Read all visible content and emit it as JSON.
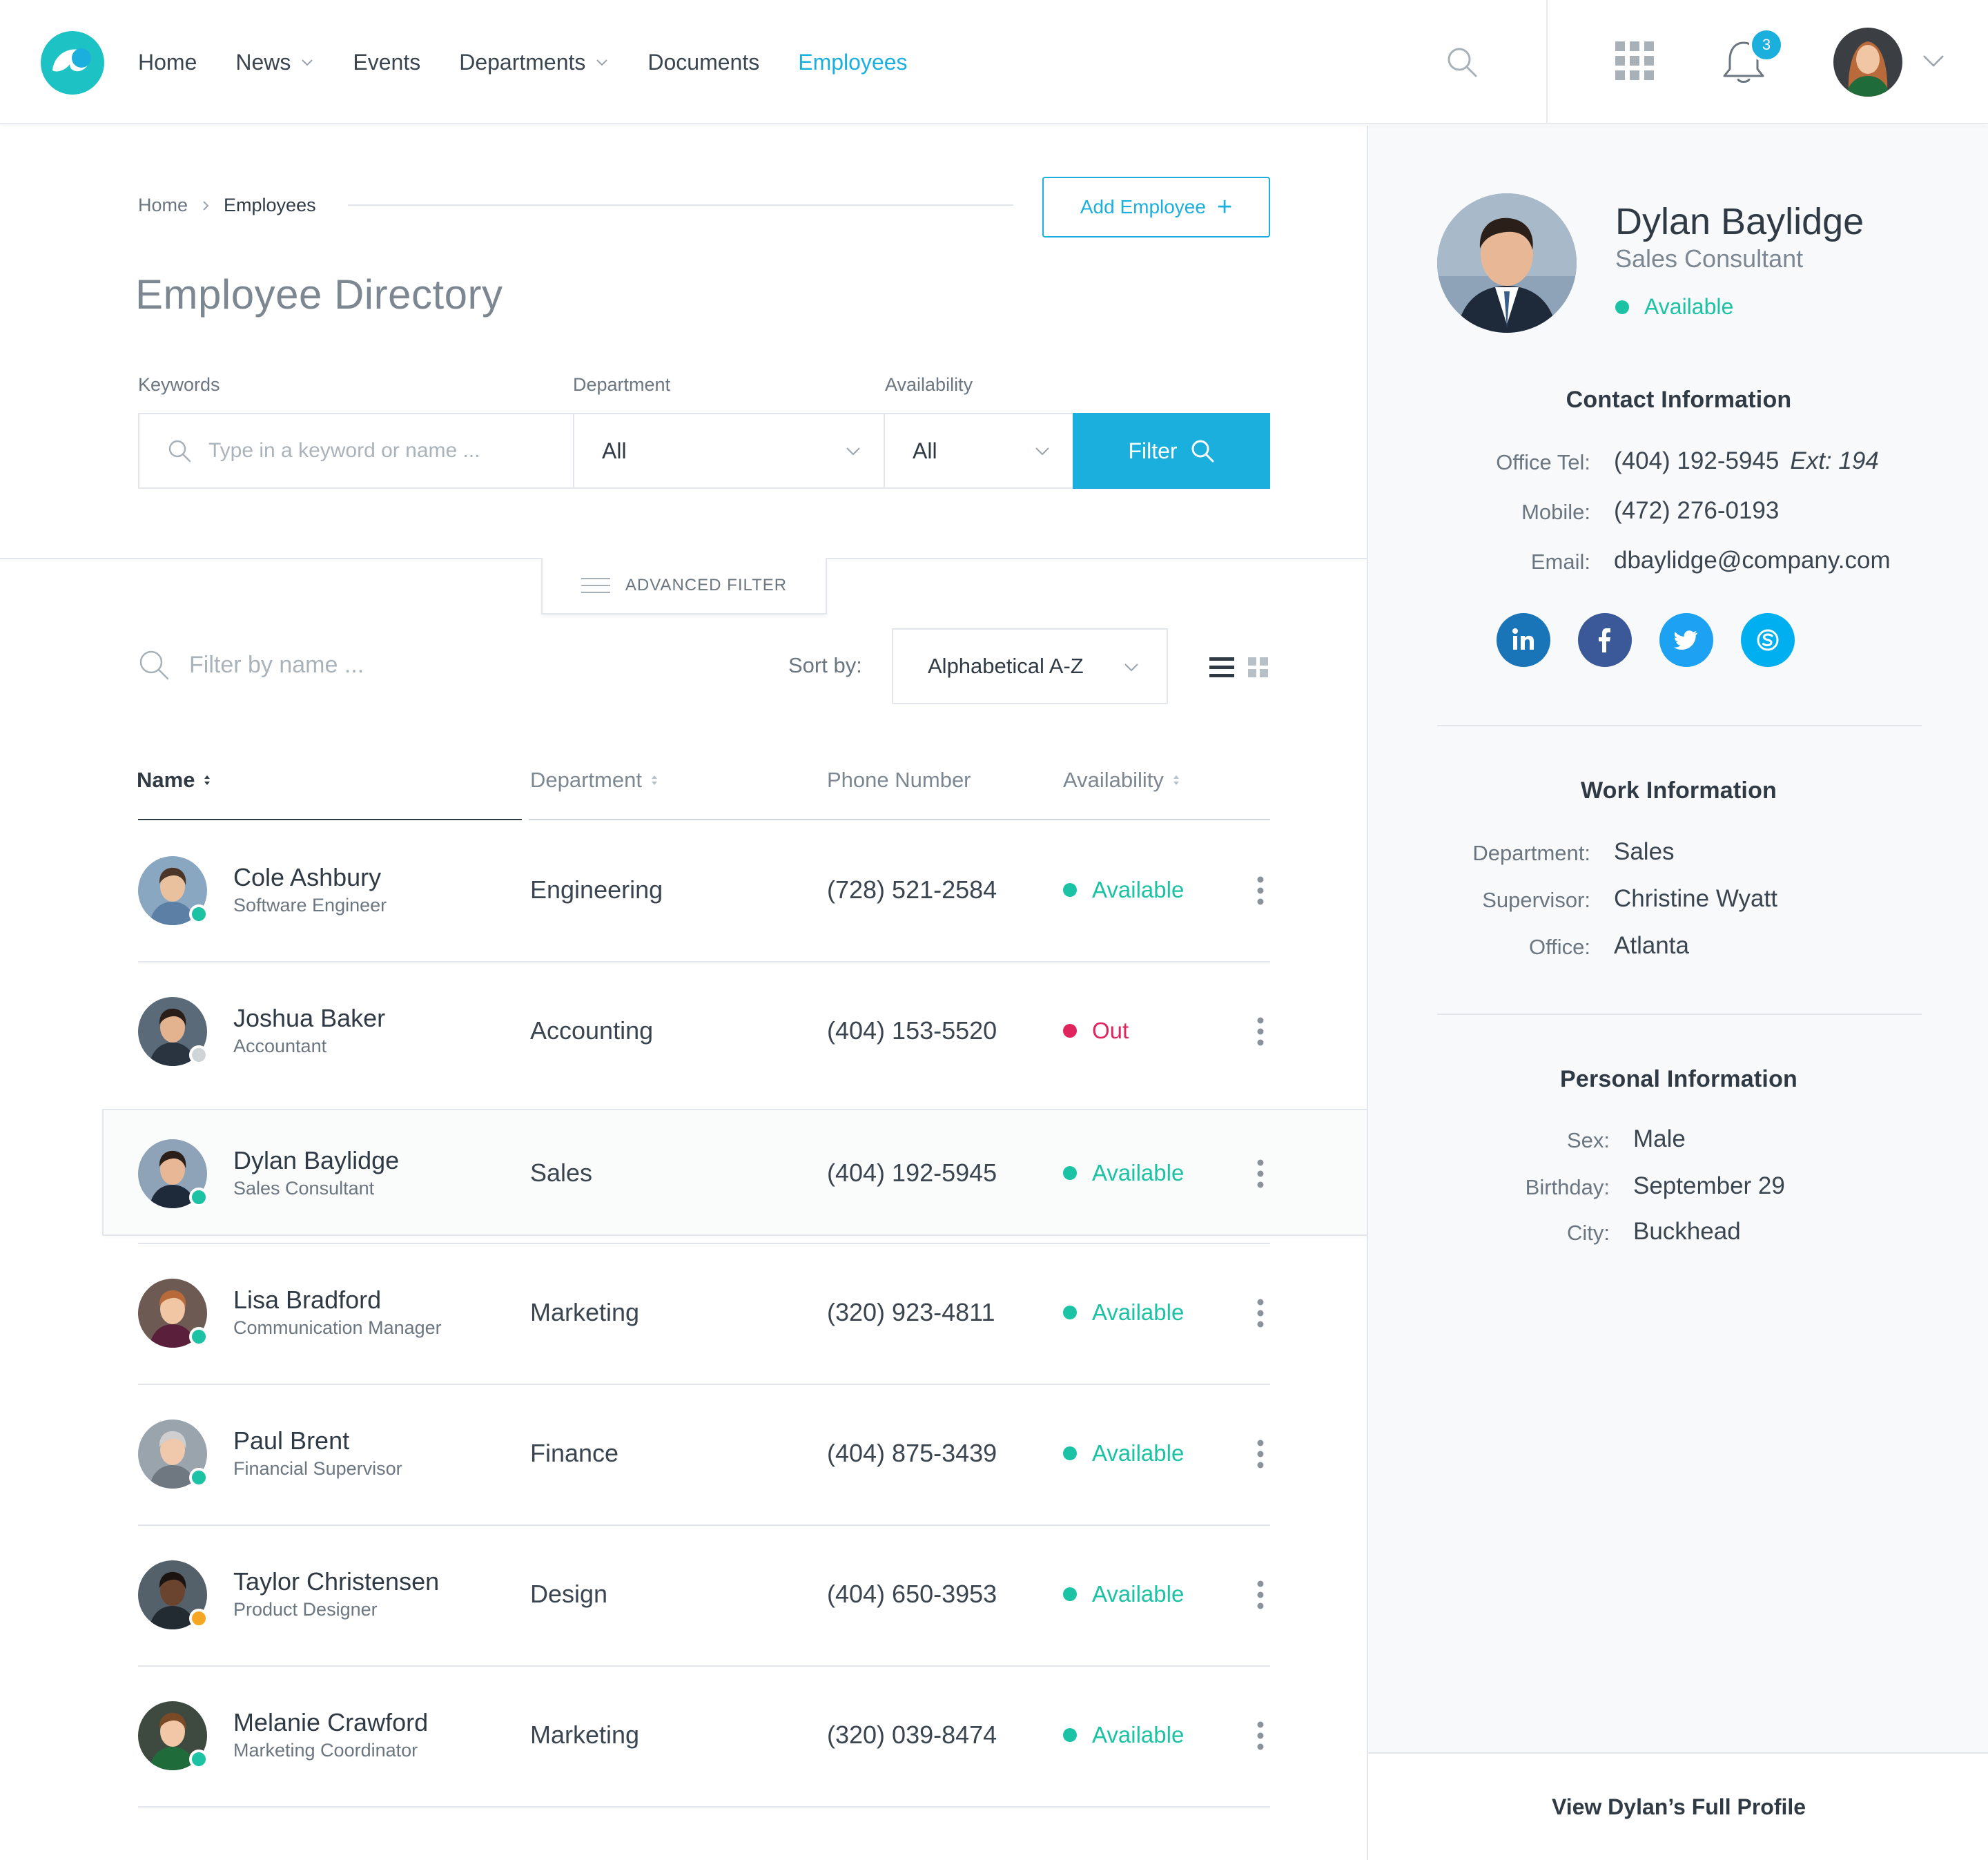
{
  "nav": {
    "items": [
      {
        "label": "Home",
        "dropdown": false,
        "active": false
      },
      {
        "label": "News",
        "dropdown": true,
        "active": false
      },
      {
        "label": "Events",
        "dropdown": false,
        "active": false
      },
      {
        "label": "Departments",
        "dropdown": true,
        "active": false
      },
      {
        "label": "Documents",
        "dropdown": false,
        "active": false
      },
      {
        "label": "Employees",
        "dropdown": false,
        "active": true
      }
    ],
    "notification_count": "3"
  },
  "breadcrumb": {
    "home": "Home",
    "current": "Employees"
  },
  "add_button": {
    "label": "Add Employee",
    "icon": "plus-icon"
  },
  "page_title": "Employee Directory",
  "filters": {
    "keywords_label": "Keywords",
    "keywords_placeholder": "Type in a keyword or name ...",
    "department_label": "Department",
    "department_value": "All",
    "availability_label": "Availability",
    "availability_value": "All",
    "filter_button": "Filter"
  },
  "advanced_filter": "ADVANCED FILTER",
  "list_controls": {
    "name_filter_placeholder": "Filter by name ...",
    "sort_label": "Sort by:",
    "sort_value": "Alphabetical A-Z"
  },
  "table": {
    "columns": [
      "Name",
      "Department",
      "Phone Number",
      "Availability"
    ],
    "rows": [
      {
        "name": "Cole Ashbury",
        "title": "Software Engineer",
        "department": "Engineering",
        "phone": "(728) 521-2584",
        "availability": "Available",
        "presence": "online"
      },
      {
        "name": "Joshua Baker",
        "title": "Accountant",
        "department": "Accounting",
        "phone": "(404) 153-5520",
        "availability": "Out",
        "presence": "offline"
      },
      {
        "name": "Dylan Baylidge",
        "title": "Sales Consultant",
        "department": "Sales",
        "phone": "(404) 192-5945",
        "availability": "Available",
        "presence": "online",
        "selected": true
      },
      {
        "name": "Lisa Bradford",
        "title": "Communication Manager",
        "department": "Marketing",
        "phone": "(320) 923-4811",
        "availability": "Available",
        "presence": "online"
      },
      {
        "name": "Paul Brent",
        "title": "Financial Supervisor",
        "department": "Finance",
        "phone": "(404) 875-3439",
        "availability": "Available",
        "presence": "online"
      },
      {
        "name": "Taylor Christensen",
        "title": "Product Designer",
        "department": "Design",
        "phone": "(404) 650-3953",
        "availability": "Available",
        "presence": "away"
      },
      {
        "name": "Melanie Crawford",
        "title": "Marketing Coordinator",
        "department": "Marketing",
        "phone": "(320) 039-8474",
        "availability": "Available",
        "presence": "online"
      }
    ]
  },
  "profile": {
    "name": "Dylan Baylidge",
    "title": "Sales Consultant",
    "status": "Available",
    "contact_title": "Contact Information",
    "contact": {
      "office_tel_label": "Office Tel:",
      "office_tel": "(404) 192-5945",
      "ext": "Ext: 194",
      "mobile_label": "Mobile:",
      "mobile": "(472) 276-0193",
      "email_label": "Email:",
      "email": "dbaylidge@company.com"
    },
    "socials": [
      "linkedin-icon",
      "facebook-icon",
      "twitter-icon",
      "skype-icon"
    ],
    "work_title": "Work Information",
    "work": {
      "department_label": "Department:",
      "department": "Sales",
      "supervisor_label": "Supervisor:",
      "supervisor": "Christine Wyatt",
      "office_label": "Office:",
      "office": "Atlanta"
    },
    "personal_title": "Personal Information",
    "personal": {
      "sex_label": "Sex:",
      "sex": "Male",
      "birthday_label": "Birthday:",
      "birthday": "September 29",
      "city_label": "City:",
      "city": "Buckhead"
    },
    "full_profile": "View Dylan’s Full Profile"
  },
  "colors": {
    "accent": "#1aafdd",
    "available": "#1cc2a4",
    "out": "#e0245e",
    "away": "#f5a623",
    "offline": "#cfd4d9",
    "text": "#2f3a45",
    "muted": "#6b7680"
  }
}
